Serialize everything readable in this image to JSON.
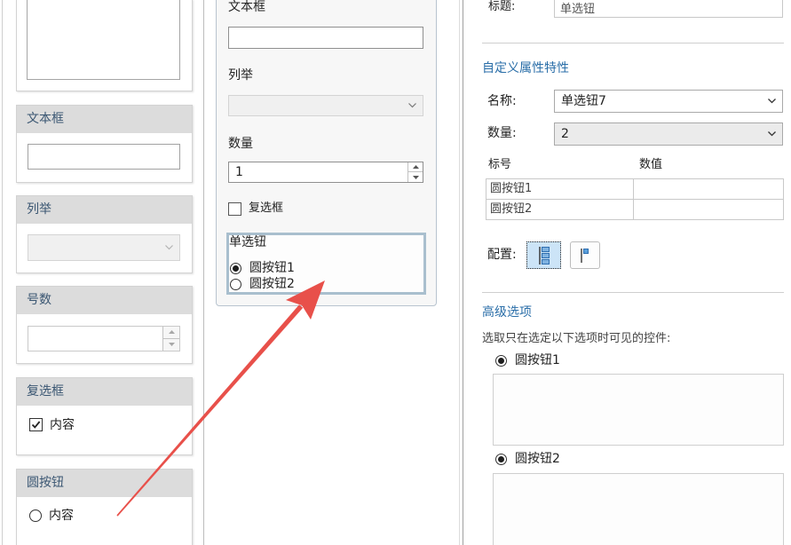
{
  "palette": {
    "text_field_card": {
      "title": "文本框"
    },
    "combo_card": {
      "title": "列举"
    },
    "spinner_card": {
      "title": "号数"
    },
    "checkbox_card": {
      "title": "复选框",
      "label": "内容",
      "checked": true
    },
    "radio_card": {
      "title": "圆按钮",
      "label": "内容",
      "checked": false
    }
  },
  "form_preview": {
    "text_field": {
      "label": "文本框"
    },
    "combo": {
      "label": "列举"
    },
    "spinner": {
      "label": "数量",
      "value": "1"
    },
    "checkbox": {
      "label": "复选框",
      "checked": false
    },
    "radio_group": {
      "title": "单选钮",
      "options": [
        {
          "label": "圆按钮1",
          "checked": true
        },
        {
          "label": "圆按钮2",
          "checked": false
        }
      ]
    }
  },
  "settings": {
    "title_label": "标题:",
    "title_value": "单选钮",
    "custom_section": {
      "heading": "自定义属性特性",
      "name_label": "名称:",
      "name_value": "单选钮7",
      "count_label": "数量:",
      "count_value": "2",
      "table": {
        "headers": [
          "标号",
          "数值"
        ],
        "rows": [
          {
            "label": "圆按钮1",
            "value": ""
          },
          {
            "label": "圆按钮2",
            "value": ""
          }
        ]
      },
      "layout_label": "配置:",
      "layout_options": [
        {
          "icon": "vertical-layout-icon",
          "selected": true
        },
        {
          "icon": "horizontal-layout-icon",
          "selected": false
        }
      ]
    },
    "advanced_section": {
      "heading": "高级选项",
      "description": "选取只在选定以下选项时可见的控件:",
      "options": [
        {
          "label": "圆按钮1",
          "checked": true
        },
        {
          "label": "圆按钮2",
          "checked": true
        }
      ]
    }
  },
  "colors": {
    "section_heading": "#2a6ea8",
    "card_header_bg": "#dcdcdc",
    "card_header_text": "#3a5672",
    "group_border": "#a9bfce",
    "selected_button_bg": "#cce4f7",
    "annotation_arrow": "#e8504a"
  }
}
